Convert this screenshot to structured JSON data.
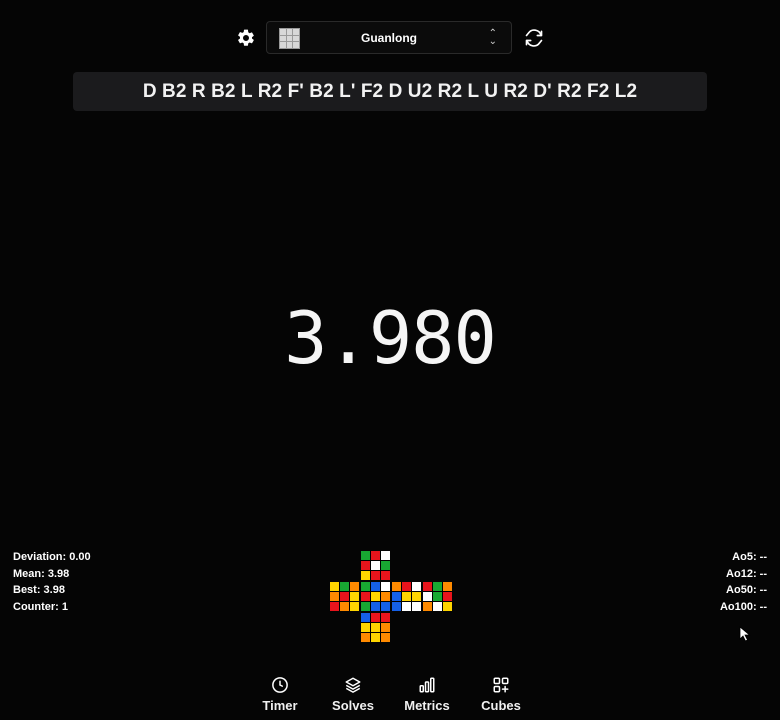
{
  "header": {
    "settings_icon": "gear-icon",
    "cube_selector": {
      "selected": "Guanlong",
      "icon": "chevron-updown-icon"
    },
    "refresh_icon": "refresh-icon"
  },
  "scramble": "D B2 R B2 L R2 F' B2 L' F2 D U2 R2 L U R2 D' R2 F2 L2",
  "timer": {
    "value": "3.980"
  },
  "stats_left": {
    "deviation": "Deviation: 0.00",
    "mean": "Mean: 3.98",
    "best": "Best: 3.98",
    "counter": "Counter: 1"
  },
  "stats_right": {
    "ao5": "Ao5: --",
    "ao12": "Ao12: --",
    "ao50": "Ao50: --",
    "ao100": "Ao100: --"
  },
  "cube_net": {
    "colors": {
      "W": "#ffffff",
      "Y": "#ffd500",
      "R": "#e8141c",
      "O": "#ff8a00",
      "G": "#18a832",
      "B": "#1560e8"
    },
    "faces": {
      "U": [
        "G",
        "R",
        "W",
        "R",
        "W",
        "G",
        "Y",
        "R",
        "R"
      ],
      "L": [
        "Y",
        "G",
        "O",
        "O",
        "R",
        "Y",
        "R",
        "O",
        "Y"
      ],
      "F": [
        "G",
        "B",
        "W",
        "R",
        "Y",
        "O",
        "G",
        "B",
        "B"
      ],
      "R": [
        "O",
        "R",
        "W",
        "B",
        "Y",
        "Y",
        "B",
        "W",
        "W"
      ],
      "B": [
        "R",
        "G",
        "O",
        "W",
        "G",
        "R",
        "O",
        "W",
        "Y"
      ],
      "D": [
        "B",
        "R",
        "R",
        "Y",
        "Y",
        "O",
        "O",
        "Y",
        "O"
      ]
    }
  },
  "nav": [
    {
      "label": "Timer",
      "icon": "clock-icon"
    },
    {
      "label": "Solves",
      "icon": "layers-icon"
    },
    {
      "label": "Metrics",
      "icon": "bar-chart-icon"
    },
    {
      "label": "Cubes",
      "icon": "grid-plus-icon"
    }
  ]
}
